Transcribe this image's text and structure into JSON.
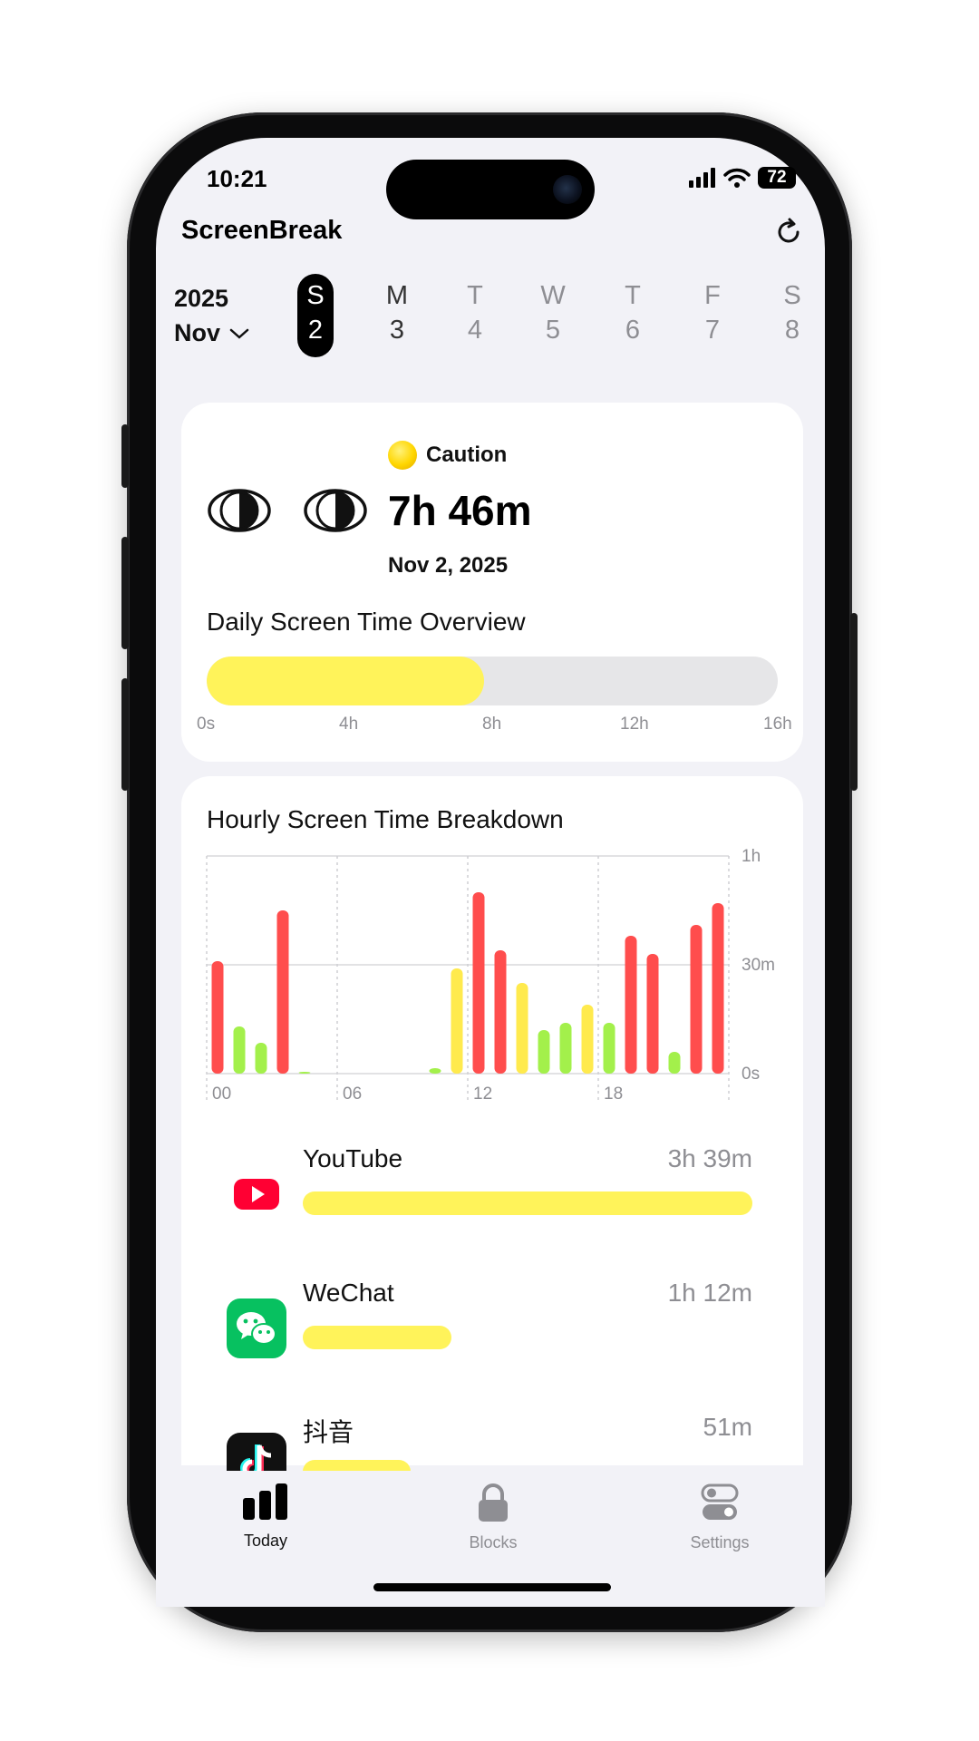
{
  "status_bar": {
    "time": "10:21",
    "battery": "72"
  },
  "header": {
    "title": "ScreenBreak"
  },
  "date_strip": {
    "year": "2025",
    "month": "Nov",
    "days": [
      {
        "letter": "S",
        "num": "2",
        "selected": true
      },
      {
        "letter": "M",
        "num": "3",
        "selected": false
      },
      {
        "letter": "T",
        "num": "4",
        "selected": false
      },
      {
        "letter": "W",
        "num": "5",
        "selected": false
      },
      {
        "letter": "T",
        "num": "6",
        "selected": false
      },
      {
        "letter": "F",
        "num": "7",
        "selected": false
      },
      {
        "letter": "S",
        "num": "8",
        "selected": false
      }
    ]
  },
  "summary": {
    "status_label": "Caution",
    "total_time": "7h 46m",
    "date": "Nov 2, 2025",
    "overview_title": "Daily Screen Time Overview",
    "overview_fraction": 0.486,
    "overview_ticks": [
      "0s",
      "4h",
      "8h",
      "12h",
      "16h"
    ]
  },
  "hourly": {
    "title": "Hourly Screen Time Breakdown",
    "chart_data": {
      "type": "bar",
      "x": [
        0,
        1,
        2,
        3,
        4,
        5,
        6,
        7,
        8,
        9,
        10,
        11,
        12,
        13,
        14,
        15,
        16,
        17,
        18,
        19,
        20,
        21,
        22,
        23
      ],
      "values": [
        31,
        13,
        8.5,
        45,
        0.5,
        0,
        0,
        0,
        0,
        0,
        1.5,
        29,
        50,
        34,
        25,
        12,
        14,
        19,
        14,
        38,
        33,
        6,
        41,
        47
      ],
      "colors": [
        "#ff4d4d",
        "#a3f04b",
        "#a3f04b",
        "#ff4d4d",
        "#a3f04b",
        "#a3f04b",
        "#a3f04b",
        "#a3f04b",
        "#a3f04b",
        "#a3f04b",
        "#a3f04b",
        "#ffea4d",
        "#ff4d4d",
        "#ff4d4d",
        "#ffea4d",
        "#a3f04b",
        "#a3f04b",
        "#ffea4d",
        "#a3f04b",
        "#ff4d4d",
        "#ff4d4d",
        "#a3f04b",
        "#ff4d4d",
        "#ff4d4d"
      ],
      "x_ticks": [
        "00",
        "06",
        "12",
        "18"
      ],
      "y_ticks": [
        "1h",
        "30m",
        "0s"
      ],
      "ylim": [
        0,
        60
      ]
    }
  },
  "apps": [
    {
      "name": "YouTube",
      "time": "3h 39m",
      "fraction": 1.0,
      "icon": "youtube-icon"
    },
    {
      "name": "WeChat",
      "time": "1h 12m",
      "fraction": 0.33,
      "icon": "wechat-icon"
    },
    {
      "name": "抖音",
      "time": "51m",
      "fraction": 0.24,
      "icon": "douyin-icon"
    }
  ],
  "tabs": [
    {
      "label": "Today",
      "icon": "bar-chart-icon",
      "active": true
    },
    {
      "label": "Blocks",
      "icon": "lock-icon",
      "active": false
    },
    {
      "label": "Settings",
      "icon": "toggles-icon",
      "active": false
    }
  ],
  "colors": {
    "accent_yellow": "#fff35a",
    "danger": "#ff4d4d",
    "ok": "#a3f04b",
    "warn": "#ffea4d"
  }
}
